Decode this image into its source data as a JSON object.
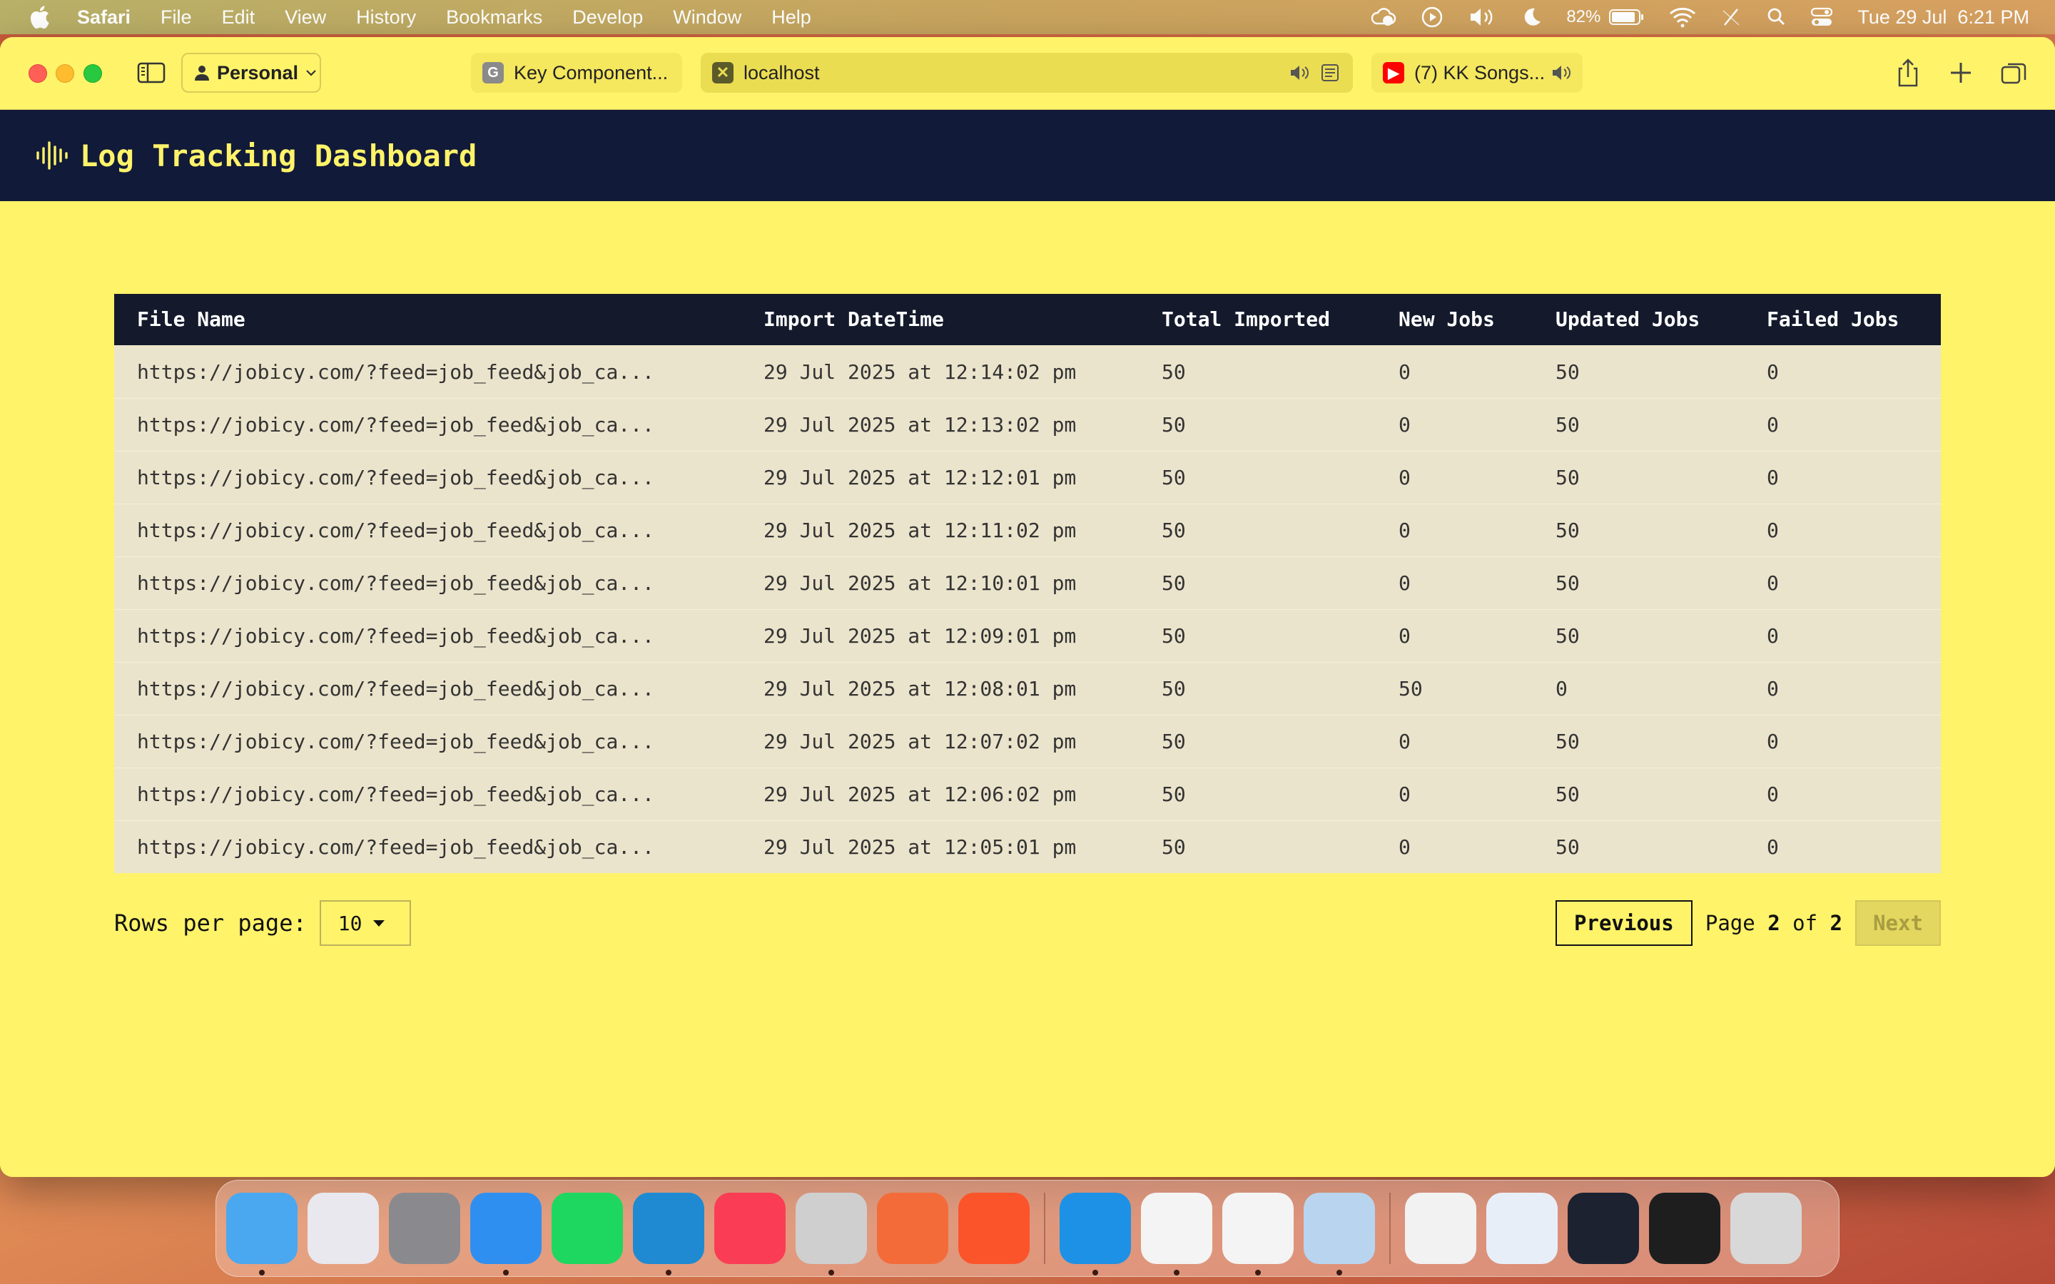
{
  "menubar": {
    "app_name": "Safari",
    "items": [
      "File",
      "Edit",
      "View",
      "History",
      "Bookmarks",
      "Develop",
      "Window",
      "Help"
    ],
    "battery": "82%",
    "datetime": "Tue 29 Jul  6:21 PM"
  },
  "browser": {
    "profile": "Personal",
    "tabs": [
      {
        "title": "Key Component...",
        "favicon": "G"
      },
      {
        "title": "localhost",
        "favicon": "✕"
      },
      {
        "title": "(7) KK Songs...",
        "favicon": "▶"
      }
    ]
  },
  "app": {
    "title": "Log Tracking Dashboard"
  },
  "table": {
    "headers": [
      "File Name",
      "Import DateTime",
      "Total Imported",
      "New Jobs",
      "Updated Jobs",
      "Failed Jobs"
    ],
    "rows": [
      [
        "https://jobicy.com/?feed=job_feed&job_ca...",
        "29 Jul 2025 at 12:14:02 pm",
        "50",
        "0",
        "50",
        "0"
      ],
      [
        "https://jobicy.com/?feed=job_feed&job_ca...",
        "29 Jul 2025 at 12:13:02 pm",
        "50",
        "0",
        "50",
        "0"
      ],
      [
        "https://jobicy.com/?feed=job_feed&job_ca...",
        "29 Jul 2025 at 12:12:01 pm",
        "50",
        "0",
        "50",
        "0"
      ],
      [
        "https://jobicy.com/?feed=job_feed&job_ca...",
        "29 Jul 2025 at 12:11:02 pm",
        "50",
        "0",
        "50",
        "0"
      ],
      [
        "https://jobicy.com/?feed=job_feed&job_ca...",
        "29 Jul 2025 at 12:10:01 pm",
        "50",
        "0",
        "50",
        "0"
      ],
      [
        "https://jobicy.com/?feed=job_feed&job_ca...",
        "29 Jul 2025 at 12:09:01 pm",
        "50",
        "0",
        "50",
        "0"
      ],
      [
        "https://jobicy.com/?feed=job_feed&job_ca...",
        "29 Jul 2025 at 12:08:01 pm",
        "50",
        "50",
        "0",
        "0"
      ],
      [
        "https://jobicy.com/?feed=job_feed&job_ca...",
        "29 Jul 2025 at 12:07:02 pm",
        "50",
        "0",
        "50",
        "0"
      ],
      [
        "https://jobicy.com/?feed=job_feed&job_ca...",
        "29 Jul 2025 at 12:06:02 pm",
        "50",
        "0",
        "50",
        "0"
      ],
      [
        "https://jobicy.com/?feed=job_feed&job_ca...",
        "29 Jul 2025 at 12:05:01 pm",
        "50",
        "0",
        "50",
        "0"
      ]
    ]
  },
  "pagination": {
    "rows_per_page_label": "Rows per page:",
    "rows_per_page_value": "10",
    "previous_label": "Previous",
    "page_word": "Page",
    "current_page": "2",
    "of_word": "of",
    "total_pages": "2",
    "next_label": "Next"
  },
  "dock": {
    "apps": [
      {
        "icon": "finder-icon",
        "color": "#4aa8f0",
        "running": true
      },
      {
        "icon": "launchpad-icon",
        "color": "#e8e8ee",
        "running": false
      },
      {
        "icon": "system-settings-icon",
        "color": "#8a8a8e",
        "running": false
      },
      {
        "icon": "safari-icon",
        "color": "#2f8ff0",
        "running": true
      },
      {
        "icon": "spotify-icon",
        "color": "#1ed760",
        "running": false
      },
      {
        "icon": "vscode-icon",
        "color": "#1f8ad2",
        "running": true
      },
      {
        "icon": "music-icon",
        "color": "#fa3d55",
        "running": false
      },
      {
        "icon": "cursor-app-icon",
        "color": "#cfcfcf",
        "running": true
      },
      {
        "icon": "postman-icon",
        "color": "#f46b3a",
        "running": false
      },
      {
        "icon": "brave-icon",
        "color": "#fb542b",
        "running": false
      }
    ],
    "apps2": [
      {
        "icon": "docker-icon",
        "color": "#1d91e6",
        "running": true
      },
      {
        "icon": "mongodb-compass-icon",
        "color": "#f4f4f4",
        "running": true
      },
      {
        "icon": "chrome-icon",
        "color": "#f4f4f4",
        "running": true
      },
      {
        "icon": "preview-icon",
        "color": "#b9d4ee",
        "running": true
      }
    ],
    "apps3": [
      {
        "icon": "mp4-file-icon",
        "color": "#f2f2f2"
      },
      {
        "icon": "window-thumbnail-icon",
        "color": "#e8eef8"
      },
      {
        "icon": "window-thumbnail-icon",
        "color": "#1c2230"
      },
      {
        "icon": "window-thumbnail-icon",
        "color": "#1e1e1e"
      },
      {
        "icon": "trash-icon",
        "color": "#d8d8d8"
      }
    ]
  }
}
